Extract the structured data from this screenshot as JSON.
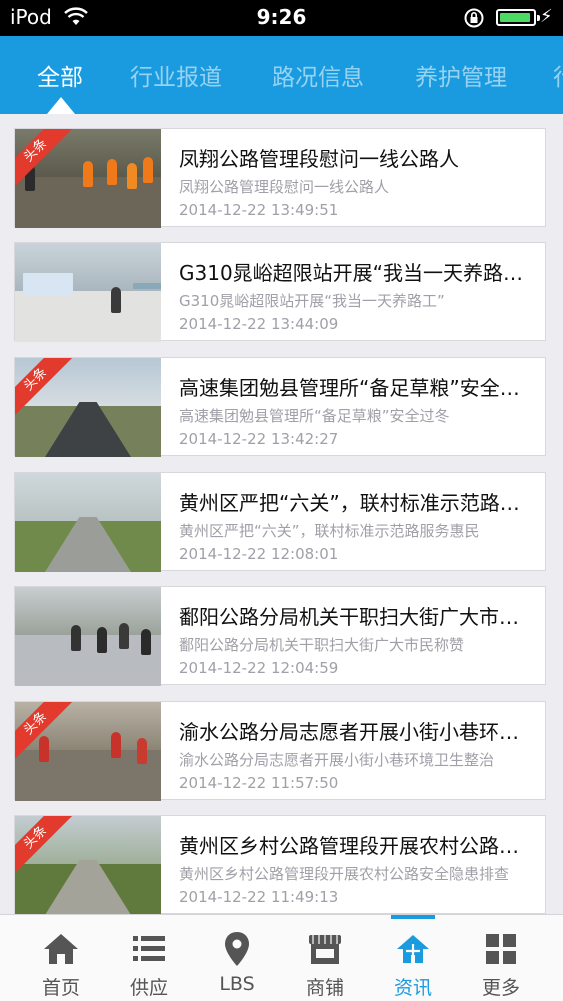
{
  "status_bar": {
    "carrier": "iPod",
    "time": "9:26",
    "battery_level": 0.95
  },
  "tabs": [
    {
      "label": "全部",
      "active": true
    },
    {
      "label": "行业报道",
      "active": false
    },
    {
      "label": "路况信息",
      "active": false
    },
    {
      "label": "养护管理",
      "active": false
    },
    {
      "label": "行",
      "active": false
    }
  ],
  "news": [
    {
      "title": "凤翔公路管理段慰问一线公路人",
      "summary": "凤翔公路管理段慰问一线公路人",
      "time": "2014-12-22 13:49:51",
      "badge": "头条"
    },
    {
      "title": "G310晁峪超限站开展“我当一天养路工”",
      "summary": "G310晁峪超限站开展“我当一天养路工”",
      "time": "2014-12-22 13:44:09",
      "badge": ""
    },
    {
      "title": "高速集团勉县管理所“备足草粮”安全过冬",
      "summary": "高速集团勉县管理所“备足草粮”安全过冬",
      "time": "2014-12-22 13:42:27",
      "badge": "头条"
    },
    {
      "title": "黄州区严把“六关”，联村标准示范路服务惠民",
      "summary": "黄州区严把“六关”，联村标准示范路服务惠民",
      "time": "2014-12-22 12:08:01",
      "badge": ""
    },
    {
      "title": "鄱阳公路分局机关干职扫大街广大市民称赞",
      "summary": "鄱阳公路分局机关干职扫大街广大市民称赞",
      "time": "2014-12-22 12:04:59",
      "badge": ""
    },
    {
      "title": "渝水公路分局志愿者开展小街小巷环境卫生整治",
      "summary": "渝水公路分局志愿者开展小街小巷环境卫生整治",
      "time": "2014-12-22 11:57:50",
      "badge": "头条"
    },
    {
      "title": "黄州区乡村公路管理段开展农村公路安全隐患排查",
      "summary": "黄州区乡村公路管理段开展农村公路安全隐患排查",
      "time": "2014-12-22 11:49:13",
      "badge": "头条"
    }
  ],
  "bottom_nav": [
    {
      "label": "首页",
      "icon": "home-icon"
    },
    {
      "label": "供应",
      "icon": "list-icon"
    },
    {
      "label": "LBS",
      "icon": "location-pin-icon"
    },
    {
      "label": "商铺",
      "icon": "shop-icon"
    },
    {
      "label": "资讯",
      "icon": "news-icon",
      "active": true
    },
    {
      "label": "更多",
      "icon": "grid-icon"
    }
  ],
  "colors": {
    "accent": "#1a9be0",
    "badge": "#e23a2c",
    "meta_text": "#a0a0a8"
  }
}
